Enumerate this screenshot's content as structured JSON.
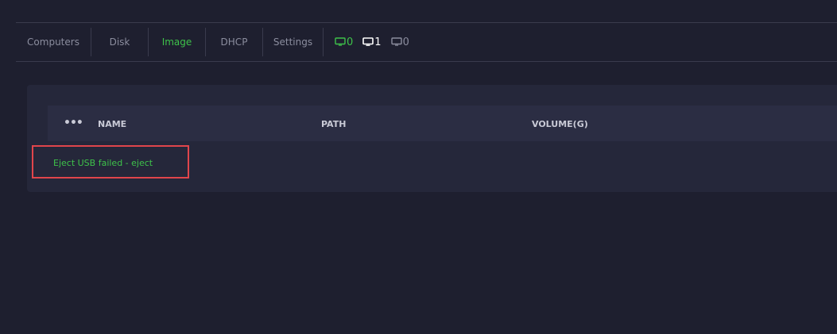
{
  "nav": {
    "tabs": [
      {
        "label": "Computers",
        "active": false
      },
      {
        "label": "Disk",
        "active": false
      },
      {
        "label": "Image",
        "active": true
      },
      {
        "label": "DHCP",
        "active": false
      },
      {
        "label": "Settings",
        "active": false
      }
    ],
    "status": [
      {
        "icon": "monitor-online-icon",
        "count": "0",
        "color": "#3ec24a"
      },
      {
        "icon": "monitor-active-icon",
        "count": "1",
        "color": "#ffffff"
      },
      {
        "icon": "monitor-offline-icon",
        "count": "0",
        "color": "#8b8d9e"
      }
    ]
  },
  "table": {
    "menu_icon": "more-icon",
    "columns": [
      "NAME",
      "PATH",
      "VOLUME(G)"
    ]
  },
  "message": "Eject USB failed - eject",
  "colors": {
    "background": "#1e1f2f",
    "accent": "#3ec24a",
    "highlight": "#e0454b"
  }
}
